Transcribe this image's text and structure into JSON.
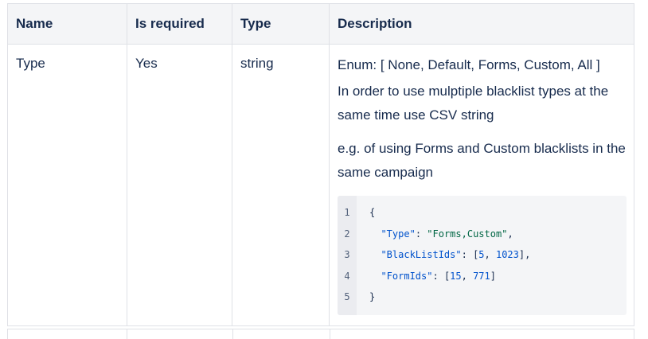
{
  "table": {
    "headers": [
      "Name",
      "Is required",
      "Type",
      "Description"
    ],
    "row": {
      "name": "Type",
      "required": "Yes",
      "type": "string",
      "description": {
        "enum_text": "Enum: [ None, Default, Forms, Custom, All ]",
        "paragraph_1": "In order to use mulptiple blacklist types at the same time use CSV string",
        "paragraph_2": "e.g. of using Forms and Custom blacklists in the same campaign"
      }
    }
  },
  "code_block": {
    "line_numbers": [
      "1",
      "2",
      "3",
      "4",
      "5"
    ],
    "lines": [
      "{",
      "  \"Type\": \"Forms,Custom\",",
      "  \"BlackListIds\": [5, 1023],",
      "  \"FormIds\": [15, 771]",
      "}"
    ],
    "colors": {
      "key": "#0052cc",
      "string": "#006644",
      "number": "#0052cc",
      "background": "#f4f5f7",
      "gutter": "#ebecf0"
    }
  }
}
